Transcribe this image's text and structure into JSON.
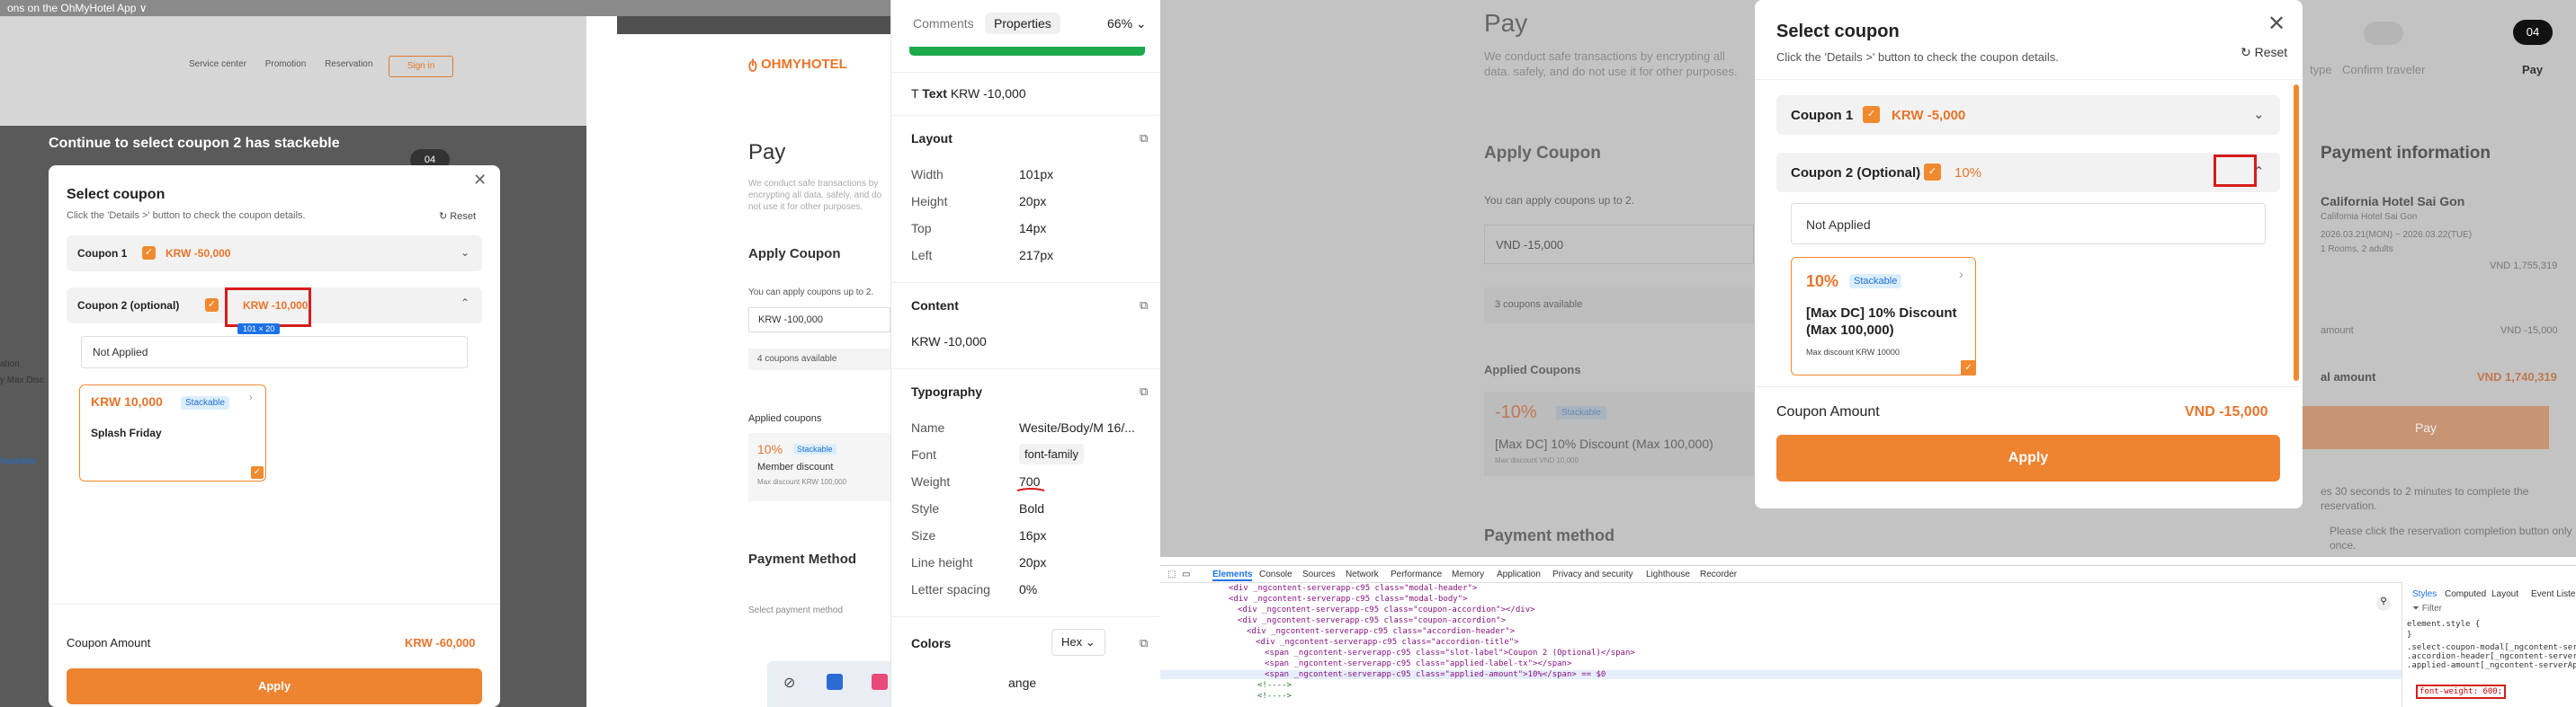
{
  "p1": {
    "crumb": "ons on the OhMyHotel App ∨",
    "nav": [
      "Service center",
      "Promotion",
      "Reservation"
    ],
    "signin": "Sign in",
    "title": "Continue to select coupon 2 has stackeble",
    "step": "04",
    "logo": "OHMYHOTEL",
    "pay": "Pay",
    "pay_desc": "We conduct safe transactions by encrypting all data. safely, and do not use it for other purposes.",
    "apply_coupon": "Apply Coupon",
    "apply_hint": "You can apply coupons up to 2.",
    "coupon_field": "KRW -100,000",
    "coupons_avail": "4 coupons available",
    "applied": "Applied coupons",
    "applied_pct": "10%",
    "applied_badge": "Stackable",
    "applied_name": "Member discount",
    "applied_max": "Max discount KRW 100,000",
    "payment_method": "Payment Method",
    "select_method": "Select payment method",
    "side1": "ation",
    "side2": "y Max Disc",
    "side3": "Stackable",
    "modal": {
      "title": "Select coupon",
      "subtitle": "Click the 'Details >' button to check the coupon details.",
      "reset": "Reset",
      "c1_label": "Coupon 1",
      "c1_value": "KRW -50,000",
      "c2_label": "Coupon 2 (optional)",
      "c2_value": "KRW -10,000",
      "dim": "101 × 20",
      "not_applied": "Not Applied",
      "card_price": "KRW 10,000",
      "card_badge": "Stackable",
      "card_name": "Splash Friday",
      "amount_label": "Coupon Amount",
      "amount_value": "KRW -60,000",
      "apply": "Apply"
    }
  },
  "figma": {
    "tab_comments": "Comments",
    "tab_properties": "Properties",
    "zoom": "66%",
    "text_label": "Text",
    "text_value": "KRW -10,000",
    "layout": "Layout",
    "width_l": "Width",
    "width_v": "101px",
    "height_l": "Height",
    "height_v": "20px",
    "top_l": "Top",
    "top_v": "14px",
    "left_l": "Left",
    "left_v": "217px",
    "content": "Content",
    "content_v": "KRW -10,000",
    "typography": "Typography",
    "name_l": "Name",
    "name_v": "Wesite/Body/M 16/...",
    "font_l": "Font",
    "font_v": "font-family",
    "weight_l": "Weight",
    "weight_v": "700",
    "style_l": "Style",
    "style_v": "Bold",
    "size_l": "Size",
    "size_v": "16px",
    "lh_l": "Line height",
    "lh_v": "20px",
    "ls_l": "Letter spacing",
    "ls_v": "0%",
    "colors": "Colors",
    "hex": "Hex",
    "orange": "ange"
  },
  "p3": {
    "pay": "Pay",
    "pay_desc": "We conduct safe transactions by encrypting all data. safely, and do not use it for other purposes.",
    "apply_coupon": "Apply Coupon",
    "apply_hint": "You can apply coupons up to 2.",
    "coupon_field": "VND -15,000",
    "coupons_avail": "3 coupons available",
    "applied": "Applied Coupons",
    "applied_pct": "-10%",
    "applied_badge": "Stackable",
    "applied_name": "[Max DC] 10% Discount (Max 100,000)",
    "applied_max": "Max discount VND 10,000",
    "payment_method": "Payment method",
    "steps": [
      "type",
      "Confirm traveler",
      "Pay"
    ],
    "step_num": "04",
    "payinfo": "Payment information",
    "hotel": "California Hotel Sai Gon",
    "hotel_sub": "California Hotel Sai Gon",
    "dates": "2026.03.21(MON) ~ 2026.03.22(TUE)",
    "guests": "1 Rooms, 2 adults",
    "price1": "VND 1,755,319",
    "discount_l": "amount",
    "price2": "VND -15,000",
    "total_l": "al amount",
    "total": "VND 1,740,319",
    "pay_btn": "Pay",
    "note1": "es 30 seconds to 2 minutes to complete the",
    "note1b": "reservation.",
    "note2": "Please click the reservation completion button only",
    "note2b": "once.",
    "modal": {
      "title": "Select coupon",
      "subtitle": "Click the 'Details >' button to check the coupon details.",
      "reset": "Reset",
      "c1_label": "Coupon 1",
      "c1_value": "KRW -5,000",
      "c2_label": "Coupon 2 (Optional)",
      "c2_value": "10%",
      "not_applied": "Not Applied",
      "card_pct": "10%",
      "card_badge": "Stackable",
      "card_name": "[Max DC] 10% Discount (Max 100,000)",
      "card_max": "Max discount KRW 10000",
      "amount_label": "Coupon Amount",
      "amount_value": "VND -15,000",
      "apply": "Apply"
    }
  },
  "dev": {
    "tabs": [
      "Elements",
      "Console",
      "Sources",
      "Network",
      "Performance",
      "Memory",
      "Application",
      "Privacy and security",
      "Lighthouse",
      "Recorder"
    ],
    "lines": [
      "<div _ngcontent-serverapp-c95 class=\"modal-header\">",
      "<div _ngcontent-serverapp-c95 class=\"modal-body\">",
      "<div _ngcontent-serverapp-c95 class=\"coupon-accordion\"></div>",
      "<div _ngcontent-serverapp-c95 class=\"coupon-accordion\">",
      "<div _ngcontent-serverapp-c95 class=\"accordion-header\">",
      "<div _ngcontent-serverapp-c95 class=\"accordion-title\">",
      "<span _ngcontent-serverapp-c95 class=\"slot-label\">Coupon 2 (Optional)</span>",
      "<span _ngcontent-serverapp-c95 class=\"applied-label-tx\"></span>",
      "<span _ngcontent-serverapp-c95 class=\"applied-amount\">10%</span> == $0",
      "<!---->",
      "<!---->"
    ],
    "side_tabs": [
      "Styles",
      "Computed",
      "Layout",
      "Event Liste"
    ],
    "filter": "Filter",
    "style_lines": [
      "element.style {",
      "}",
      ".select-coupon-modal[_ngcontent-server",
      ".accordion-header[_ngcontent-serverApp",
      ".applied-amount[_ngcontent-serverApp-c"
    ],
    "fw": "font-weight: 600;"
  },
  "taskbar": [
    "wifi-off",
    "app-1",
    "app-2",
    "mcafee",
    "outlook"
  ]
}
